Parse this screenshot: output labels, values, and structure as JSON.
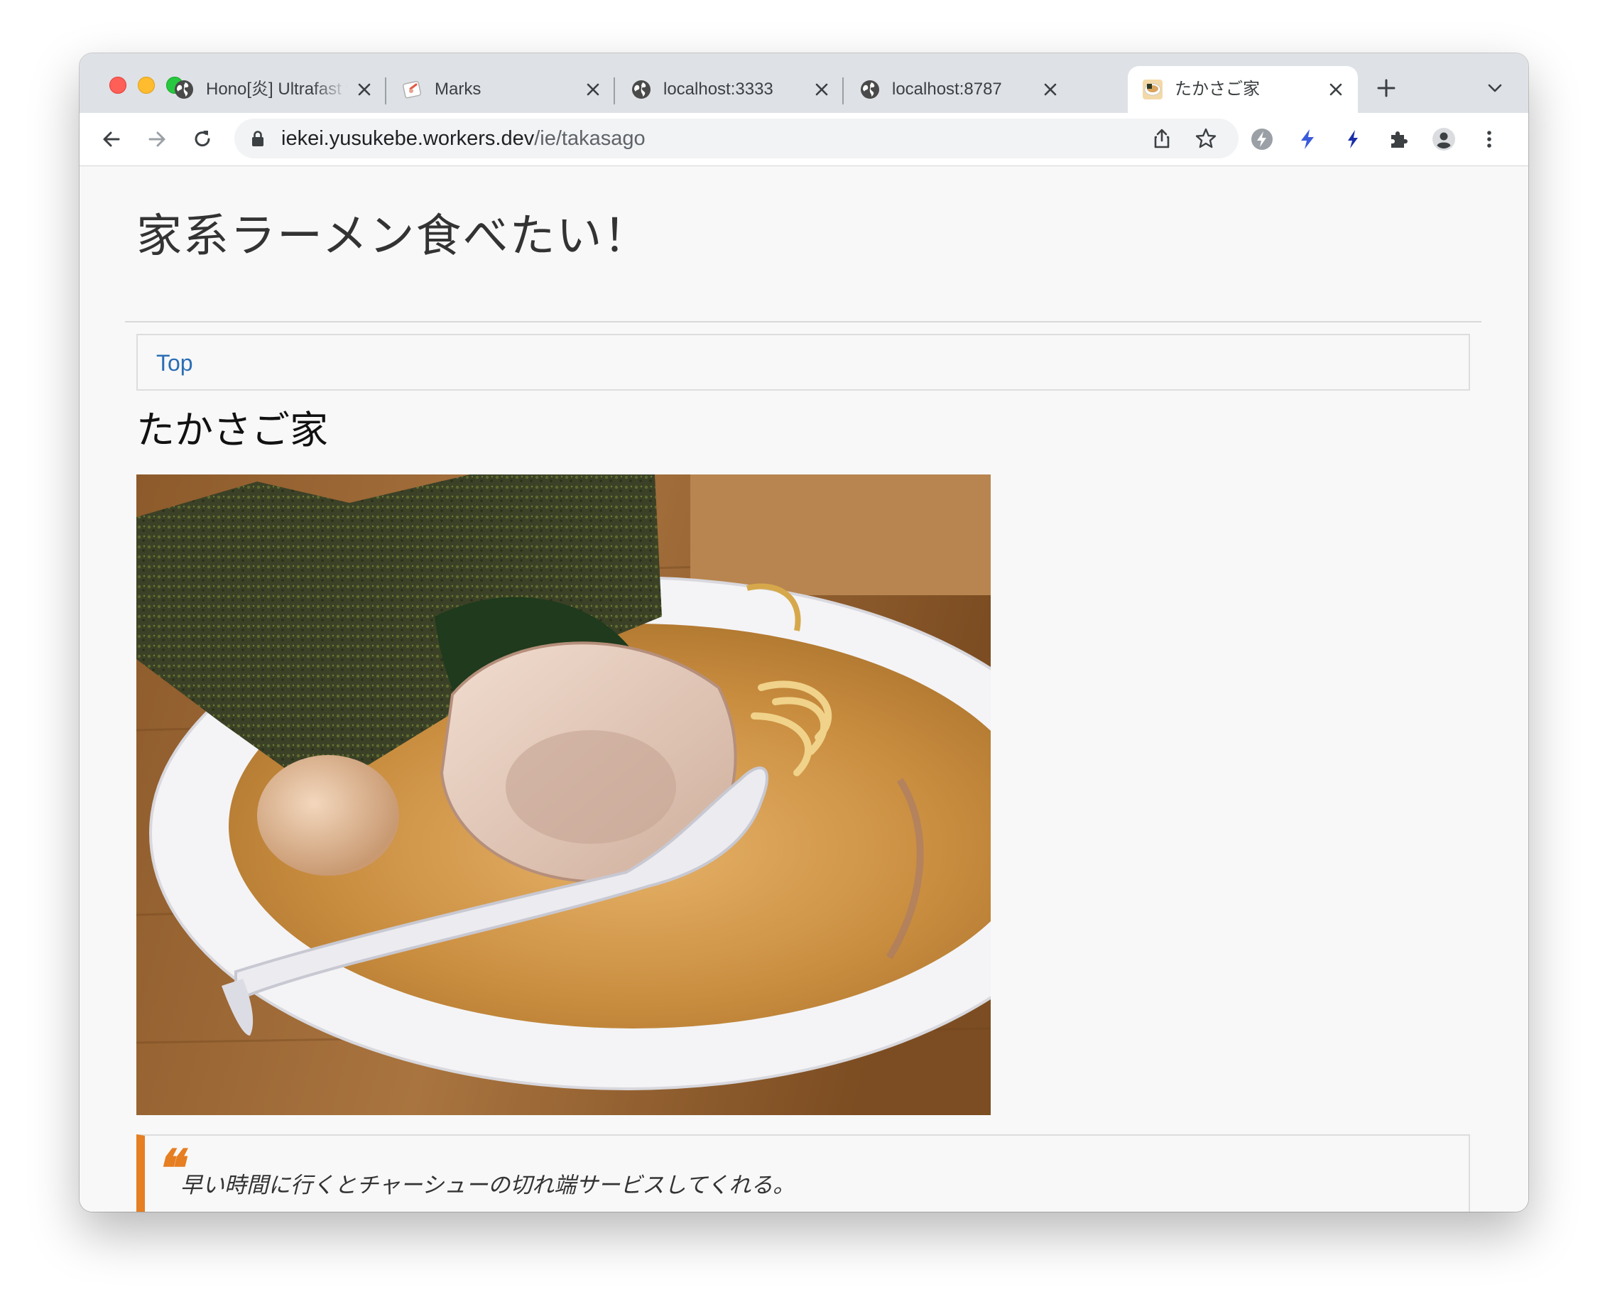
{
  "browser": {
    "tabs": [
      {
        "title": "Hono[炎] Ultrafast web framework for Cloudflare Workers",
        "favicon": "globe-icon",
        "active": false
      },
      {
        "title": "Marks",
        "favicon": "marks-favicon",
        "active": false
      },
      {
        "title": "localhost:3333",
        "favicon": "globe-icon",
        "active": false
      },
      {
        "title": "localhost:8787",
        "favicon": "globe-icon",
        "active": false
      },
      {
        "title": "たかさご家",
        "favicon": "ramen-favicon",
        "active": true
      }
    ],
    "url": {
      "host": "iekei.yusukebe.workers.dev",
      "path": "/ie/takasago"
    }
  },
  "page": {
    "site_title": "家系ラーメン食べたい！",
    "nav_link": "Top",
    "shop_name": "たかさご家",
    "quote_mark": "❝",
    "comment": "早い時間に行くとチャーシューの切れ端サービスしてくれる。"
  },
  "colors": {
    "accent": "#e67e22",
    "link": "#2a6eb5"
  }
}
